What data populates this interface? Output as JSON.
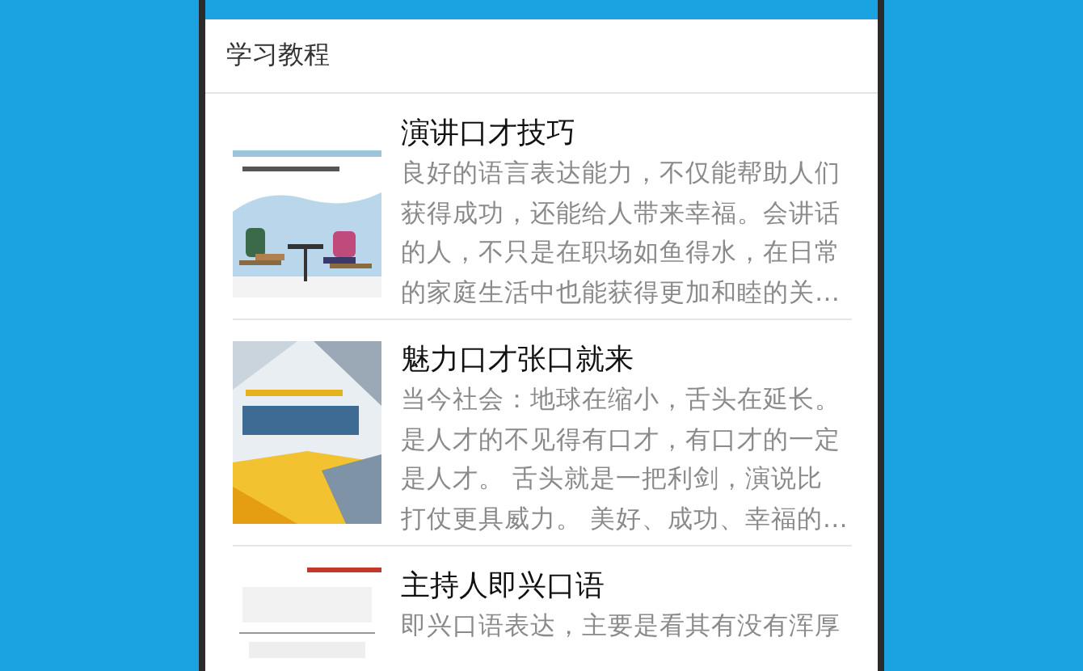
{
  "section_title": "学习教程",
  "tutorials": [
    {
      "kind": "speech",
      "title": "演讲口才技巧",
      "description_lines": [
        "良好的语言表达能力，不仅能帮助人们",
        "获得成功，还能给人带来幸福。会讲话",
        "的人，不只是在职场如鱼得水，在日常",
        "的家庭生活中也能获得更加和睦的关…"
      ]
    },
    {
      "kind": "charm",
      "title": "魅力口才张口就来",
      "description_lines": [
        "当今社会：地球在缩小，舌头在延长。",
        "是人才的不见得有口才，有口才的一定",
        "是人才。 舌头就是一把利剑，演说比",
        "打仗更具威力。 美好、成功、幸福的…"
      ]
    },
    {
      "kind": "host",
      "title": "主持人即兴口语",
      "description_lines": [
        "即兴口语表达，主要是看其有没有浑厚"
      ]
    }
  ]
}
